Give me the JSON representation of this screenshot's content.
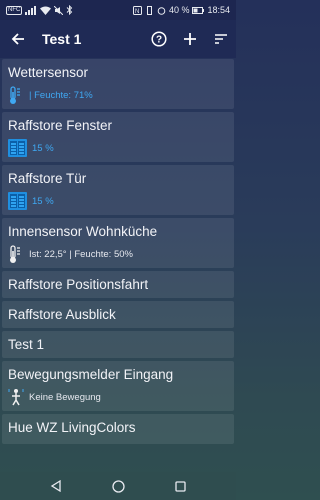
{
  "status": {
    "battery": "40 %",
    "time": "18:54"
  },
  "appbar": {
    "title": "Test 1"
  },
  "cards": [
    {
      "title": "Wettersensor",
      "sub": "| Feuchte: 71%",
      "icon": "thermometer-blue-icon"
    },
    {
      "title": "Raffstore Fenster",
      "sub": "15 %",
      "icon": "blind-icon"
    },
    {
      "title": "Raffstore Tür",
      "sub": "15 %",
      "icon": "blind-icon"
    },
    {
      "title": "Innensensor Wohnküche",
      "sub": "Ist: 22,5° | Feuchte: 50%",
      "icon": "thermometer-icon"
    },
    {
      "title": "Raffstore Positionsfahrt"
    },
    {
      "title": "Raffstore Ausblick"
    },
    {
      "title": "Test 1"
    },
    {
      "title": "Bewegungsmelder Eingang",
      "sub": "Keine Bewegung",
      "icon": "motion-person-icon"
    },
    {
      "title": "Hue WZ LivingColors"
    }
  ],
  "colors": {
    "accent_blue": "#3fa8f2",
    "appbar": "#1f2a55"
  }
}
